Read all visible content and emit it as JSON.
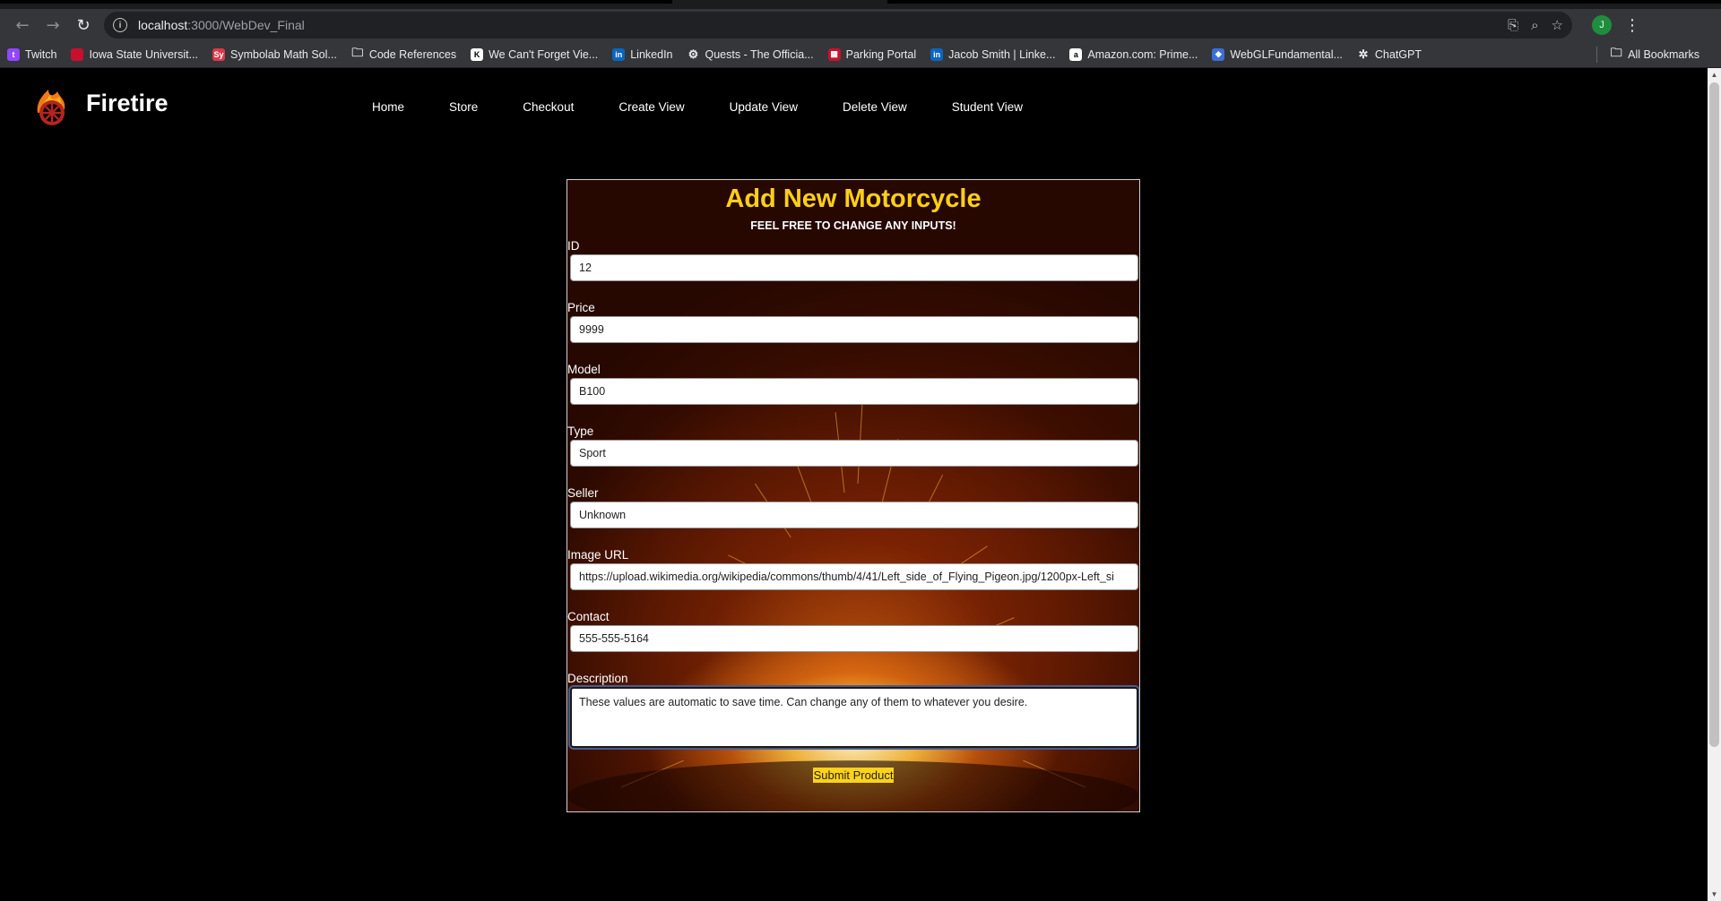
{
  "browser": {
    "url_host": "localhost",
    "url_path": ":3000/WebDev_Final",
    "profile_initial": "J",
    "bookmarks": [
      {
        "label": "Twitch",
        "icon": "twitch-icon",
        "color": "#9146ff",
        "glyph": "t"
      },
      {
        "label": "Iowa State Universit...",
        "icon": "iowa-state-icon",
        "color": "#c8102e",
        "glyph": ""
      },
      {
        "label": "Symbolab Math Sol...",
        "icon": "symbolab-icon",
        "color": "#d93a4a",
        "glyph": "Sy"
      },
      {
        "label": "Code References",
        "icon": "folder-icon",
        "color": "transparent",
        "glyph": "🗀"
      },
      {
        "label": "We Can't Forget Vie...",
        "icon": "kickstarter-icon",
        "color": "#ffffff",
        "glyph": "K"
      },
      {
        "label": "LinkedIn",
        "icon": "linkedin-icon",
        "color": "#0a66c2",
        "glyph": "in"
      },
      {
        "label": "Quests - The Officia...",
        "icon": "quests-icon",
        "color": "transparent",
        "glyph": "⚙"
      },
      {
        "label": "Parking Portal",
        "icon": "parking-icon",
        "color": "#c8102e",
        "glyph": "▦"
      },
      {
        "label": "Jacob Smith | Linke...",
        "icon": "linkedin-icon",
        "color": "#0a66c2",
        "glyph": "in"
      },
      {
        "label": "Amazon.com: Prime...",
        "icon": "amazon-icon",
        "color": "#ffffff",
        "glyph": "a"
      },
      {
        "label": "WebGLFundamental...",
        "icon": "webgl-icon",
        "color": "#3b6fd8",
        "glyph": "◆"
      },
      {
        "label": "ChatGPT",
        "icon": "chatgpt-icon",
        "color": "transparent",
        "glyph": "✲"
      }
    ],
    "all_bookmarks_label": "All Bookmarks"
  },
  "site": {
    "brand": "Firetire",
    "nav": [
      "Home",
      "Store",
      "Checkout",
      "Create View",
      "Update View",
      "Delete View",
      "Student View"
    ]
  },
  "form": {
    "title": "Add New Motorcycle",
    "subtitle": "FEEL FREE TO CHANGE ANY INPUTS!",
    "fields": [
      {
        "label": "ID",
        "value": "12"
      },
      {
        "label": "Price",
        "value": "9999"
      },
      {
        "label": "Model",
        "value": "B100"
      },
      {
        "label": "Type",
        "value": "Sport"
      },
      {
        "label": "Seller",
        "value": "Unknown"
      },
      {
        "label": "Image URL",
        "value": "https://upload.wikimedia.org/wikipedia/commons/thumb/4/41/Left_side_of_Flying_Pigeon.jpg/1200px-Left_si"
      },
      {
        "label": "Contact",
        "value": "555-555-5164"
      }
    ],
    "description_label": "Description",
    "description_value": "These values are automatic to save time. Can change any of them to whatever you desire.",
    "submit_label": "Submit Product",
    "accent_color": "#ffcf17"
  }
}
